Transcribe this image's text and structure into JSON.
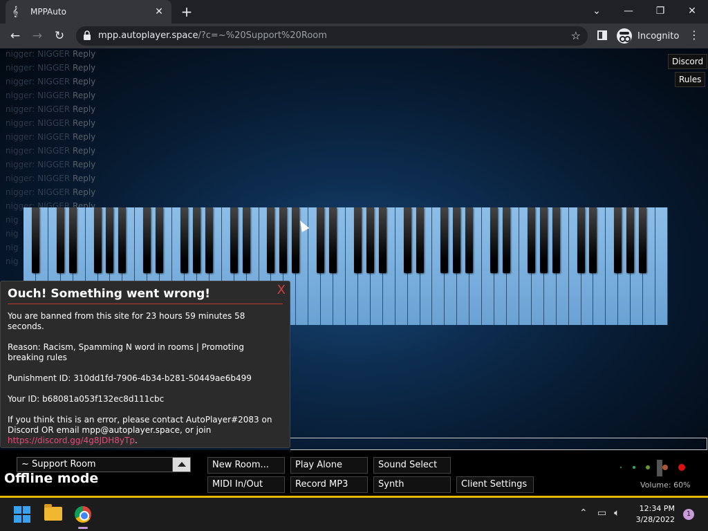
{
  "browser": {
    "tab_title": "MPPAuto",
    "tab_close": "✕",
    "new_tab": "+",
    "url_host": "mpp.autoplayer.space",
    "url_path": "/?c=~%20Support%20Room",
    "incognito_label": "Incognito"
  },
  "chat": {
    "lines": [
      {
        "user": "nigger:",
        "msg": "NIGGER",
        "reply": "Reply"
      },
      {
        "user": "nigger:",
        "msg": "NIGGER",
        "reply": "Reply"
      },
      {
        "user": "nigger:",
        "msg": "NIGGER",
        "reply": "Reply"
      },
      {
        "user": "nigger:",
        "msg": "NIGGER",
        "reply": "Reply"
      },
      {
        "user": "nigger:",
        "msg": "NIGGER",
        "reply": "Reply"
      },
      {
        "user": "nigger:",
        "msg": "NIGGER",
        "reply": "Reply"
      },
      {
        "user": "nigger:",
        "msg": "NIGGER",
        "reply": "Reply"
      },
      {
        "user": "nigger:",
        "msg": "NIGGER",
        "reply": "Reply"
      },
      {
        "user": "nigger:",
        "msg": "NIGGER",
        "reply": "Reply"
      },
      {
        "user": "nigger:",
        "msg": "NIGGER",
        "reply": "Reply"
      },
      {
        "user": "nigger:",
        "msg": "NIGGER",
        "reply": "Reply"
      },
      {
        "user": "nigger:",
        "msg": "NIGGER",
        "reply": "Reply"
      },
      {
        "user": "nig",
        "msg": "",
        "reply": ""
      },
      {
        "user": "nig",
        "msg": "",
        "reply": ""
      },
      {
        "user": "nig",
        "msg": "",
        "reply": ""
      },
      {
        "user": "nig",
        "msg": "",
        "reply": ""
      }
    ]
  },
  "top_buttons": {
    "discord": "Discord",
    "rules": "Rules"
  },
  "modal": {
    "close": "X",
    "title": "Ouch! Something went wrong!",
    "ban_message": "You are banned from this site for 23 hours 59 minutes 58 seconds.",
    "reason": "Reason: Racism, Spamming N word in rooms | Promoting breaking rules",
    "punishment_id": "Punishment ID: 310dd1fd-7906-4b34-b281-50449ae6b499",
    "your_id": "Your ID: b68081a053f132ec8d111cbc",
    "contact_text": "If you think this is an error, please contact AutoPlayer#2083 on Discord OR email mpp@autoplayer.space, or join ",
    "contact_link": "https://discord.gg/4g8JDH8yTp",
    "contact_end": "."
  },
  "controls": {
    "room_name": "~ Support Room",
    "offline_label": "Offline mode",
    "new_room": "New Room...",
    "play_alone": "Play Alone",
    "sound_select": "Sound Select",
    "midi": "MIDI In/Out",
    "record_mp3": "Record MP3",
    "synth": "Synth",
    "client_settings": "Client Settings",
    "volume_label": "Volume: 60%"
  },
  "taskbar": {
    "time": "12:34 PM",
    "date": "3/28/2022",
    "notification_count": "1"
  },
  "colors": {
    "accent_stripe": "#e6b800",
    "piano_white": "#8dbee8",
    "link": "#e74c7a"
  }
}
